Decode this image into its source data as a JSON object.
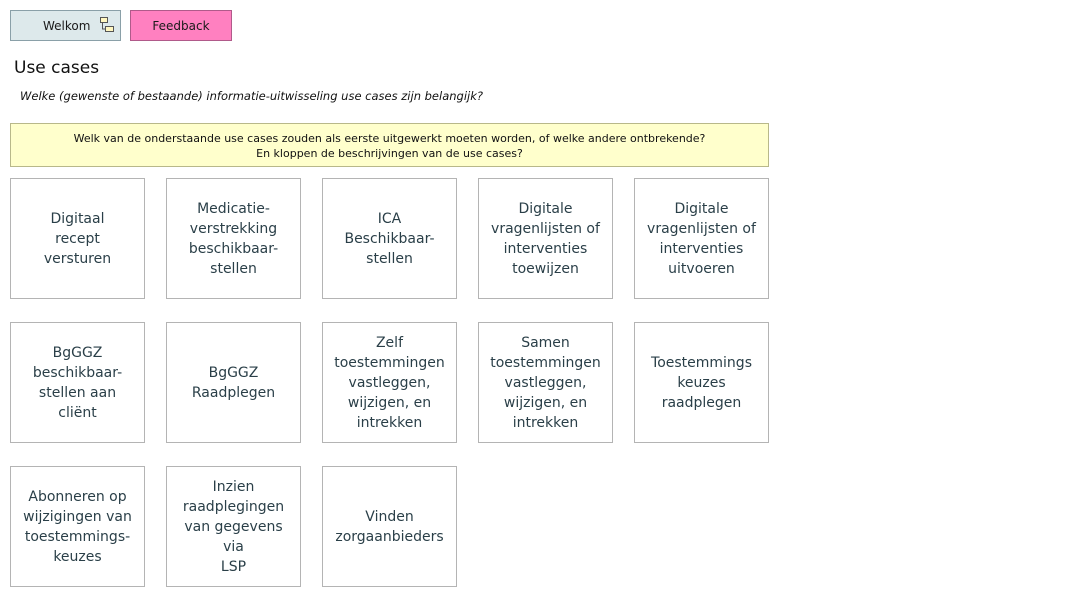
{
  "nav": {
    "welkom_label": "Welkom",
    "feedback_label": "Feedback"
  },
  "header": {
    "title": "Use cases",
    "subtitle": "Welke (gewenste of bestaande) informatie-uitwisseling use cases zijn belangijk?"
  },
  "note": {
    "line1": "Welk van de onderstaande use cases zouden als eerste uitgewerkt moeten worden, of welke andere ontbrekende?",
    "line2": "En kloppen de beschrijvingen van de use cases?"
  },
  "use_cases": [
    "Digitaal\nrecept\nversturen",
    "Medicatie-\nverstrekking\nbeschikbaar-\nstellen",
    "ICA\nBeschikbaar-\nstellen",
    "Digitale\nvragenlijsten of\ninterventies\ntoewijzen",
    "Digitale\nvragenlijsten of\ninterventies\nuitvoeren",
    "BgGGZ\nbeschikbaar-\nstellen aan cliënt",
    "BgGGZ\nRaadplegen",
    "Zelf\ntoestemmingen\nvastleggen,\nwijzigen, en\nintrekken",
    "Samen\ntoestemmingen\nvastleggen,\nwijzigen, en\nintrekken",
    "Toestemmings\nkeuzes\nraadplegen",
    "Abonneren op\nwijzigingen van\ntoestemmings-\nkeuzes",
    "Inzien\nraadplegingen\nvan gegevens via\nLSP",
    "Vinden\nzorgaanbieders"
  ],
  "colors": {
    "welkom_bg": "#dde9eb",
    "feedback_bg": "#ff80c0",
    "note_bg": "#ffffcc"
  }
}
